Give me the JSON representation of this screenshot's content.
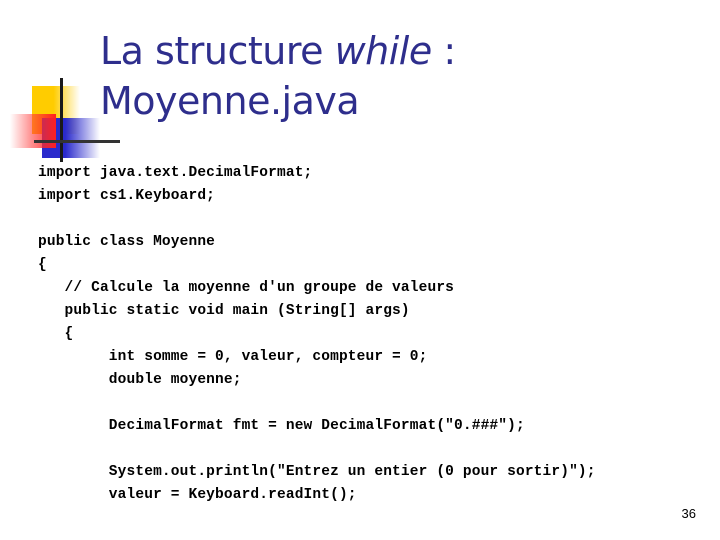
{
  "slide": {
    "title_prefix": "La structure ",
    "title_keyword": "while",
    "title_suffix": " :",
    "title_line2": "Moyenne.java",
    "page_number": "36",
    "accent_colors": {
      "title": "#2e2e8c",
      "logo_yellow": "#ffcc00",
      "logo_blue": "#2a2acc",
      "logo_red": "#ff2020"
    }
  },
  "code": {
    "lines": [
      "import java.text.DecimalFormat;",
      "import cs1.Keyboard;",
      "",
      "public class Moyenne",
      "{",
      "   // Calcule la moyenne d'un groupe de valeurs",
      "   public static void main (String[] args)",
      "   {",
      "        int somme = 0, valeur, compteur = 0;",
      "        double moyenne;",
      "",
      "        DecimalFormat fmt = new DecimalFormat(\"0.###\");",
      "",
      "        System.out.println(\"Entrez un entier (0 pour sortir)\");",
      "        valeur = Keyboard.readInt();"
    ]
  }
}
